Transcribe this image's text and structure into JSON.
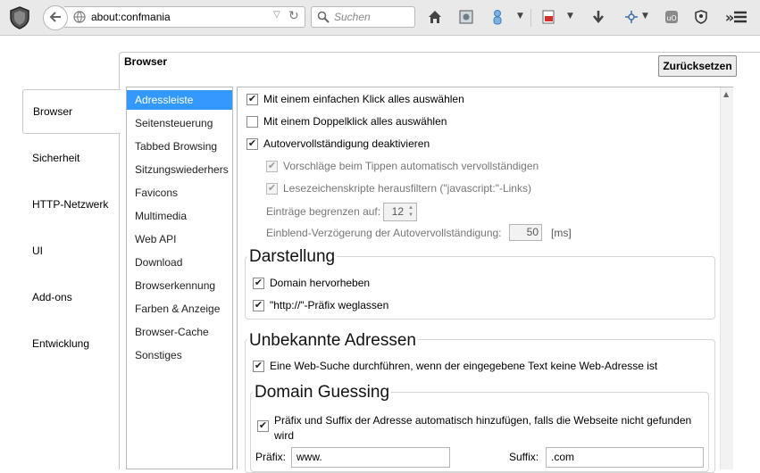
{
  "toolbar": {
    "url": "about:confmania",
    "search_placeholder": "Suchen",
    "icons": [
      "shield-icon",
      "back-arrow-icon",
      "globe-icon",
      "home-icon",
      "screenshot-icon",
      "user-icon",
      "pdf-icon",
      "download-icon",
      "network-icon",
      "ublock-icon",
      "privacy-icon",
      "overflow-icon",
      "menu-icon"
    ]
  },
  "left_tabs": [
    "Browser",
    "Sicherheit",
    "HTTP-Netzwerk",
    "UI",
    "Add-ons",
    "Entwicklung"
  ],
  "panel": {
    "title": "Browser",
    "reset_label": "Zurücksetzen"
  },
  "subnav": [
    "Adressleiste",
    "Seitensteuerung",
    "Tabbed Browsing",
    "Sitzungswiederhers",
    "Favicons",
    "Multimedia",
    "Web API",
    "Download",
    "Browserkennung",
    "Farben & Anzeige",
    "Browser-Cache",
    "Sonstiges"
  ],
  "options": {
    "single_click": {
      "label": "Mit einem einfachen Klick alles auswählen",
      "checked": true
    },
    "double_click": {
      "label": "Mit einem Doppelklick alles auswählen",
      "checked": false
    },
    "autocomplete_off": {
      "label": "Autovervollständigung deaktivieren",
      "checked": true
    },
    "suggest_typing": {
      "label": "Vorschläge beim Tippen automatisch vervollständigen",
      "checked": true
    },
    "filter_bookmarklets": {
      "label": "Lesezeichenskripte herausfiltern (\"javascript:\"-Links)",
      "checked": true
    },
    "limit_label": "Einträge begrenzen auf:",
    "limit_value": "12",
    "delay_label": "Einblend-Verzögerung der Autovervollständigung:",
    "delay_value": "50",
    "delay_unit": "[ms]"
  },
  "darstellung": {
    "title": "Darstellung",
    "highlight_domain": {
      "label": "Domain hervorheben",
      "checked": true
    },
    "hide_http": {
      "label": "\"http://\"-Präfix weglassen",
      "checked": true
    }
  },
  "unknown": {
    "title": "Unbekannte Adressen",
    "web_search": {
      "label": "Eine Web-Suche durchführen, wenn der eingegebene Text keine Web-Adresse ist",
      "checked": true
    }
  },
  "guessing": {
    "title": "Domain Guessing",
    "auto_fix_line1": "Präfix und Suffix der Adresse automatisch hinzufügen, falls die Webseite nicht gefunden",
    "auto_fix_line2": "wird",
    "auto_fix_checked": true,
    "prefix_label": "Präfix:",
    "prefix_value": "www.",
    "suffix_label": "Suffix:",
    "suffix_value": ".com"
  },
  "colors": {
    "accent": "#3399ff",
    "toolbar_bg": "#e9e9e9"
  }
}
